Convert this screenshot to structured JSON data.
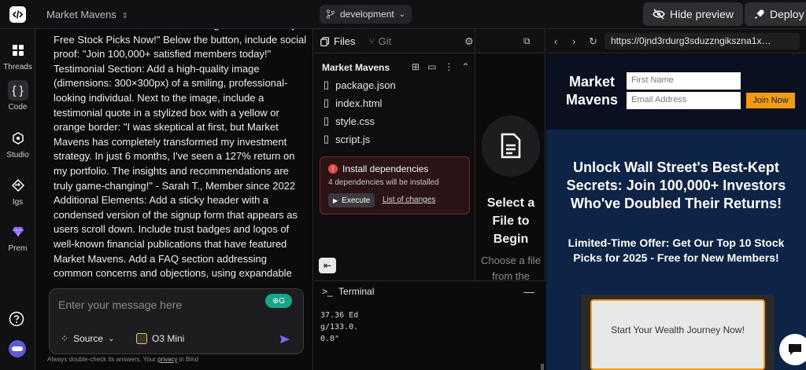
{
  "topbar": {
    "project_name": "Market Mavens",
    "branch": "development",
    "hide_preview_label": "Hide preview",
    "deploy_label": "Deploy"
  },
  "rail": {
    "items": [
      {
        "label": "Threads",
        "icon": "grid-icon"
      },
      {
        "label": "Code",
        "icon": "code-braces-icon"
      },
      {
        "label": "Studio",
        "icon": "cube-icon"
      },
      {
        "label": "Igs",
        "icon": "diamond-arrow-icon"
      },
      {
        "label": "Prem",
        "icon": "gem-icon"
      }
    ],
    "accent": "#8b5cf6"
  },
  "chat": {
    "message": "Add a bold CTA button in contrasting color: \"Claim My Free Stock Picks Now!\" Below the button, include social proof: \"Join 100,000+ satisfied members today!\" Testimonial Section: Add a high-quality image (dimensions: 300×300px) of a smiling, professional-looking individual. Next to the image, include a testimonial quote in a stylized box with a yellow or orange border: \"I was skeptical at first, but Market Mavens has completely transformed my investment strategy. In just 6 months, I've seen a 127% return on my portfolio. The insights and recommendations are truly game-changing!\" - Sarah T., Member since 2022 Additional Elements: Add a sticky header with a condensed version of the signup form that appears as users scroll down. Include trust badges and logos of well-known financial publications that have featured Market Mavens. Add a FAQ section addressing common concerns and objections, using expandable",
    "composer_placeholder": "Enter your message here",
    "source_label": "Source",
    "model_label": "O3 Mini",
    "disclaimer_prefix": "Always double-check its answers. Your",
    "disclaimer_link": "privacy",
    "disclaimer_suffix": "in Bind"
  },
  "files": {
    "tab_files": "Files",
    "tab_git": "Git",
    "tree_title": "Market Mavens",
    "items": [
      "package.json",
      "index.html",
      "style.css",
      "script.js"
    ],
    "dependency_title": "Install dependencies",
    "dependency_sub": "4 dependencies will be installed",
    "execute_label": "Execute",
    "changes_label": "List of changes"
  },
  "editor": {
    "select_title": "Select a File to Begin",
    "select_sub": "Choose a file from the"
  },
  "terminal": {
    "title": "Terminal",
    "output": "37.36 Ed\ng/133.0.\n0.0\""
  },
  "preview": {
    "url": "https://0jnd3rdurg3sduzzngikszna1x…",
    "site": {
      "logo": "Market Mavens",
      "first_name_placeholder": "First Name",
      "email_placeholder": "Email Address",
      "join_label": "Join Now",
      "hero_title": "Unlock Wall Street's Best-Kept Secrets: Join 100,000+ Investors Who've Doubled Their Returns!",
      "hero_sub": "Limited-Time Offer: Get Our Top 10 Stock Picks for 2025 - Free for New Members!",
      "cta_label": "Start Your Wealth Journey Now!"
    }
  }
}
